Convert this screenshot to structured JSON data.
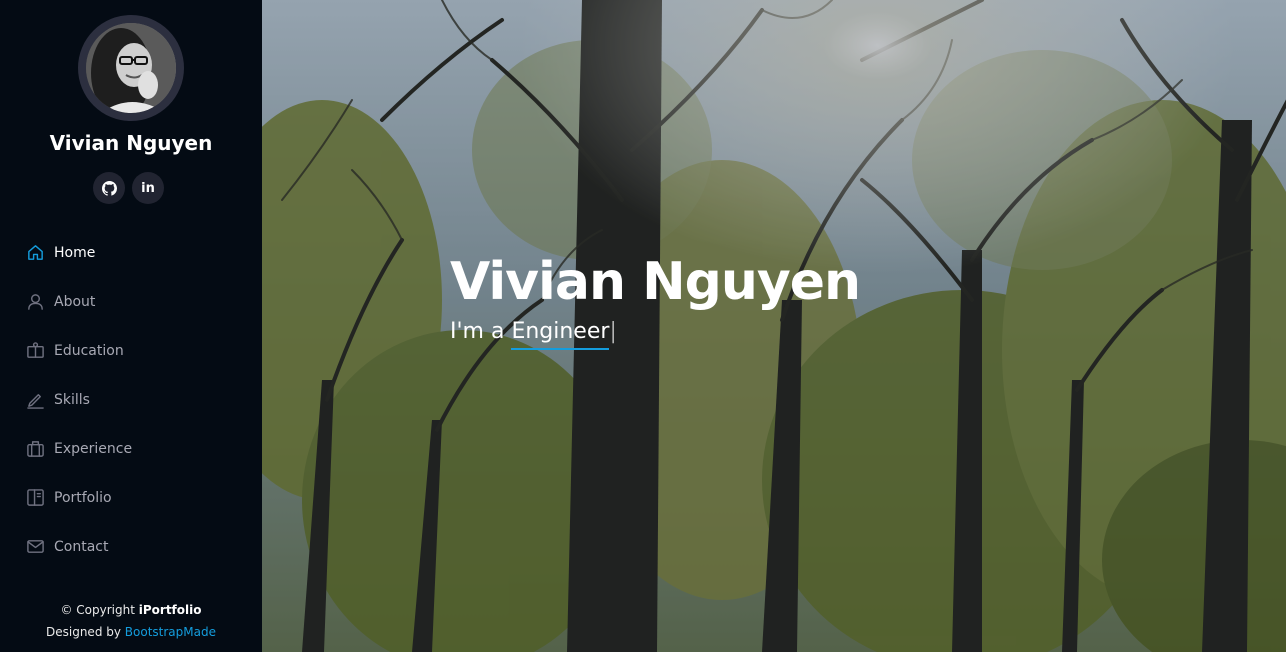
{
  "profile": {
    "name": "Vivian Nguyen",
    "avatar_icon": "profile-photo"
  },
  "socials": [
    {
      "name": "github",
      "icon": "github-icon"
    },
    {
      "name": "linkedin",
      "icon": "linkedin-icon",
      "label": "in"
    }
  ],
  "nav": {
    "items": [
      {
        "label": "Home",
        "icon": "home-icon",
        "active": true
      },
      {
        "label": "About",
        "icon": "person-icon",
        "active": false
      },
      {
        "label": "Education",
        "icon": "book-icon",
        "active": false
      },
      {
        "label": "Skills",
        "icon": "pencil-icon",
        "active": false
      },
      {
        "label": "Experience",
        "icon": "briefcase-icon",
        "active": false
      },
      {
        "label": "Portfolio",
        "icon": "layout-icon",
        "active": false
      },
      {
        "label": "Contact",
        "icon": "envelope-icon",
        "active": false
      }
    ]
  },
  "footer": {
    "copyright_prefix": "© Copyright ",
    "brand": "iPortfolio",
    "designed_prefix": "Designed by ",
    "designer": "BootstrapMade"
  },
  "hero": {
    "title": "Vivian Nguyen",
    "subtitle_prefix": "I'm a ",
    "typed_text": "Engineer",
    "cursor": "|"
  },
  "colors": {
    "accent": "#149ddd",
    "sidebar_bg": "#040b14",
    "social_bg": "#212431",
    "nav_text": "#a8a9b4"
  }
}
